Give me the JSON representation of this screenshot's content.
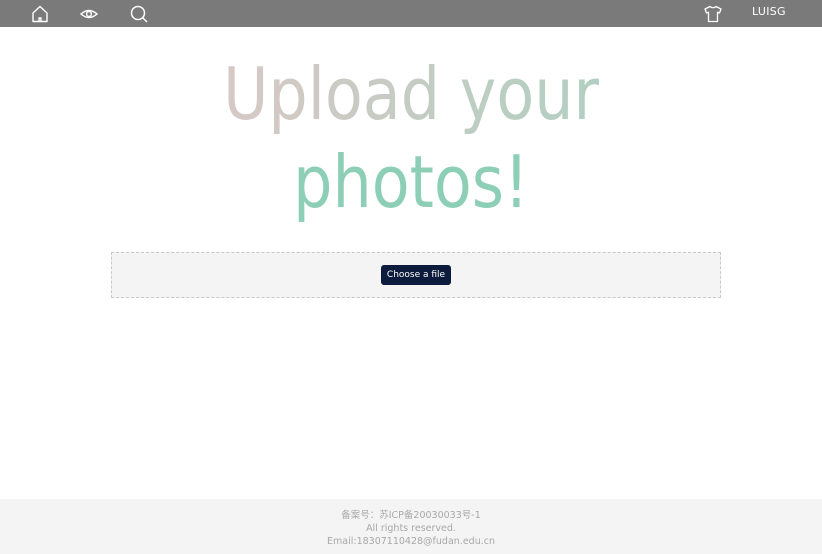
{
  "navbar": {
    "icons": {
      "home": "home-icon",
      "eye": "eye-icon",
      "search": "search-icon",
      "shirt": "shirt-icon"
    },
    "username": "LUISG",
    "background": "#7a7a7a"
  },
  "hero": {
    "line1": "Upload your",
    "line2": "photos!",
    "colors": {
      "line1_gradient": [
        "#e6c8c8",
        "#9ecfbc"
      ],
      "line2": "#8ccfb6"
    }
  },
  "upload": {
    "button_label": "Choose a file",
    "button_color": "#0d1c3d"
  },
  "footer": {
    "icp": "备案号：苏ICP备20030033号-1",
    "rights": "All rights reserved.",
    "email": "Email:18307110428@fudan.edu.cn"
  }
}
